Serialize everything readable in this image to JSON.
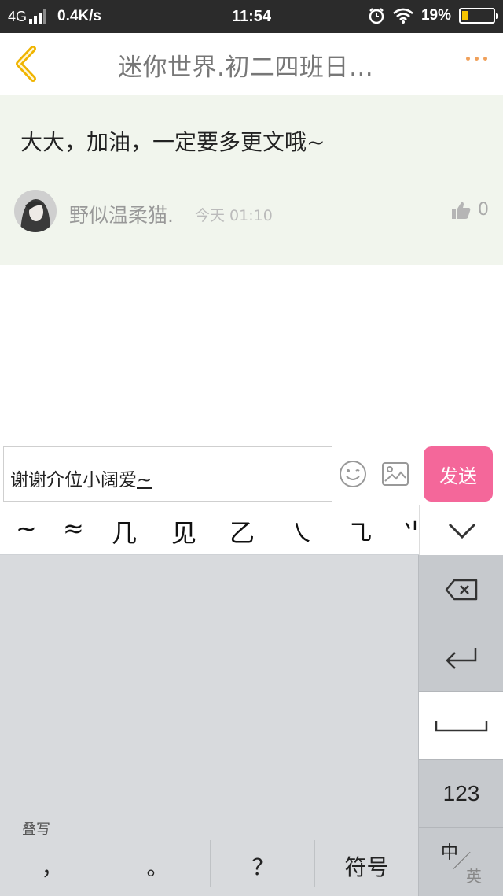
{
  "status_bar": {
    "network": "4G",
    "speed": "0.4K/s",
    "time": "11:54",
    "battery_percent": "19%",
    "battery_level": 0.19
  },
  "header": {
    "title": "迷你世界.初二四班日…",
    "back_icon": "chevron-left-icon",
    "more_icon": "more-dots-icon",
    "accent_color": "#f0a05a"
  },
  "comment": {
    "text": "大大，加油，一定要多更文哦~",
    "username": "野似温柔猫.",
    "time": "今天 01:10",
    "likes": "0",
    "like_icon": "thumbs-up-icon",
    "background": "#f1f5ed"
  },
  "reply": {
    "input_value_main": "谢谢介位小阔爱",
    "input_value_composing": "~",
    "emoji_icon": "smiley-icon",
    "image_icon": "image-icon",
    "send_label": "发送",
    "send_color": "#f4679a"
  },
  "candidates": [
    "~",
    "≈",
    "几",
    "见",
    "乙",
    "㇏",
    "㇈",
    "⺌"
  ],
  "keyboard": {
    "handwriting_mode_label": "叠写",
    "bottom_keys": [
      "，",
      "。",
      "？",
      "符号"
    ],
    "side_keys": {
      "backspace_icon": "backspace-icon",
      "enter_icon": "enter-icon",
      "space_icon": "space-icon",
      "numbers_label": "123",
      "lang_zh": "中",
      "lang_en": "英"
    },
    "collapse_icon": "chevron-down-icon"
  }
}
